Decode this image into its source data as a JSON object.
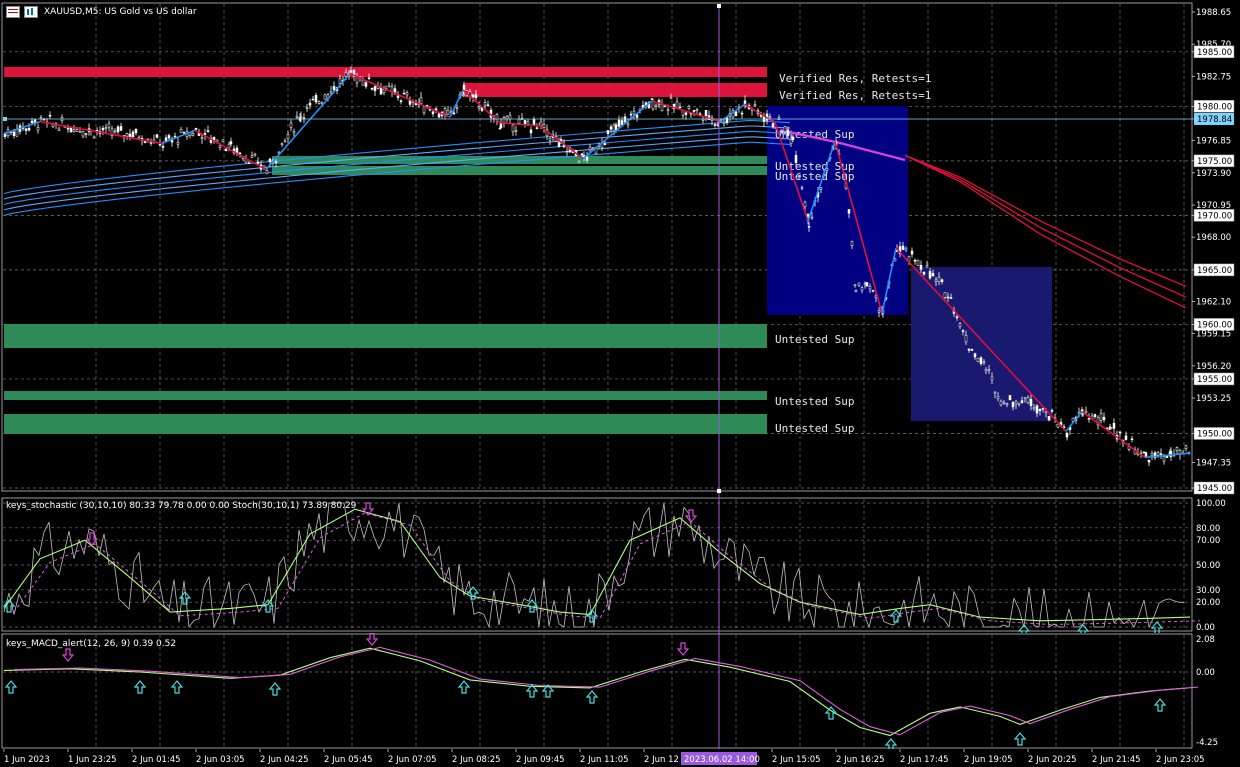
{
  "window": {
    "title": "XAUUSD,M5: US Gold vs US dollar",
    "icons": [
      "chart-window-icon",
      "chart-type-icon"
    ]
  },
  "main_chart": {
    "price_labels": [
      "1988.65",
      "1985.70",
      "1985.00",
      "1982.75",
      "1980.00",
      "1978.84",
      "1976.85",
      "1975.00",
      "1973.90",
      "1970.95",
      "1970.00",
      "1968.00",
      "1965.00",
      "1962.10",
      "1960.00",
      "1959.15",
      "1956.20",
      "1955.00",
      "1953.25",
      "1950.00",
      "1947.35",
      "1945.00"
    ],
    "current_price": "1978.84",
    "zones": [
      {
        "label": "Verified Res, Retests=1",
        "type": "resistance"
      },
      {
        "label": "Verified Res, Retests=1",
        "type": "resistance"
      },
      {
        "label": "Untested Sup",
        "type": "support"
      },
      {
        "label": "Untested Sup",
        "type": "support"
      },
      {
        "label": "Untested Sup",
        "type": "support"
      },
      {
        "label": "Untested Sup",
        "type": "support"
      },
      {
        "label": "Untested Sup",
        "type": "support"
      },
      {
        "label": "Untested Sup",
        "type": "support"
      }
    ],
    "colors": {
      "resistance": "#dc143c",
      "support": "#2e8b57",
      "box1": "#000080",
      "box2": "#191970",
      "uptrend": "#1e90ff",
      "downtrend": "#e0103a",
      "candle": "#ffffff"
    }
  },
  "stochastic": {
    "title": "keys_stochastic (30,10,10) 80.33 79.78 0.00 0.00 Stoch(30,10,1) 73.89 80.29",
    "levels": [
      "100.00",
      "80.00",
      "70.00",
      "50.00",
      "30.00",
      "20.00",
      "0.00"
    ]
  },
  "macd": {
    "title": "keys_MACD_alert(12, 26, 9) 0.39 0.52",
    "levels": [
      "2.08",
      "0.00",
      "-4.25"
    ]
  },
  "time_axis": {
    "labels": [
      "1 Jun 2023",
      "1 Jun 23:25",
      "2 Jun 01:45",
      "2 Jun 03:05",
      "2 Jun 04:25",
      "2 Jun 05:45",
      "2 Jun 07:05",
      "2 Jun 08:25",
      "2 Jun 09:45",
      "2 Jun 11:05",
      "2 Jun 12",
      "2 Jun 15:05",
      "2 Jun 16:25",
      "2 Jun 17:45",
      "2 Jun 19:05",
      "2 Jun 20:25",
      "2 Jun 21:45",
      "2 Jun 23:05"
    ],
    "cursor_time": "2023.06.02 14:00"
  }
}
